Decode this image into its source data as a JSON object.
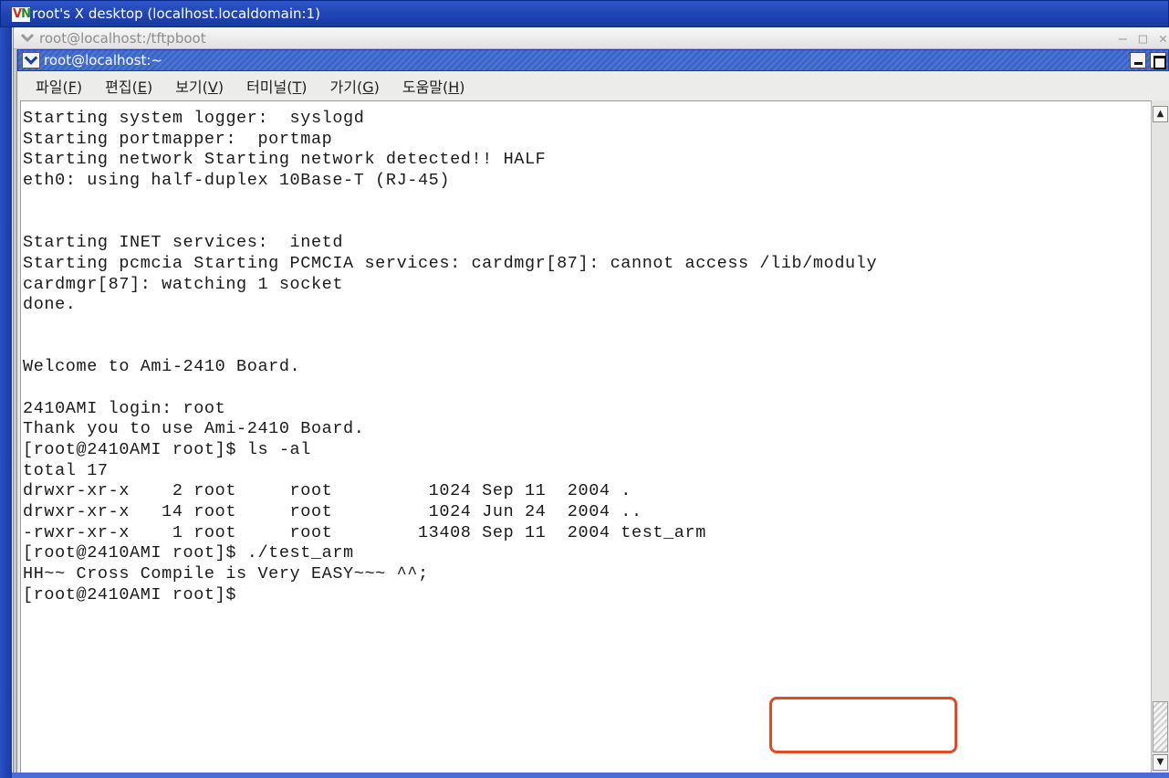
{
  "vnc": {
    "logo_v": "V",
    "logo_n": "N",
    "title": "root's X desktop (localhost.localdomain:1)"
  },
  "back_window": {
    "title": "root@localhost:/tftpboot",
    "controls": "– □ ✕"
  },
  "terminal": {
    "title": "root@localhost:~",
    "menu": [
      {
        "label": "파일(",
        "accel": "F",
        "tail": ")"
      },
      {
        "label": "편집(",
        "accel": "E",
        "tail": ")"
      },
      {
        "label": "보기(",
        "accel": "V",
        "tail": ")"
      },
      {
        "label": "터미널(",
        "accel": "T",
        "tail": ")"
      },
      {
        "label": "가기(",
        "accel": "G",
        "tail": ")"
      },
      {
        "label": "도움말(",
        "accel": "H",
        "tail": ")"
      }
    ],
    "lines": [
      "Starting system logger:  syslogd",
      "Starting portmapper:  portmap",
      "Starting network Starting network detected!! HALF",
      "eth0: using half-duplex 10Base-T (RJ-45)",
      "",
      "",
      "Starting INET services:  inetd",
      "Starting pcmcia Starting PCMCIA services: cardmgr[87]: cannot access /lib/moduly",
      "cardmgr[87]: watching 1 socket",
      "done.",
      "",
      "",
      "Welcome to Ami-2410 Board.",
      "",
      "2410AMI login: root",
      "Thank you to use Ami-2410 Board.",
      "[root@2410AMI root]$ ls -al",
      "total 17",
      "drwxr-xr-x    2 root     root         1024 Sep 11  2004 .",
      "drwxr-xr-x   14 root     root         1024 Jun 24  2004 ..",
      "-rwxr-xr-x    1 root     root        13408 Sep 11  2004 test_arm",
      "[root@2410AMI root]$ ./test_arm",
      "HH~~ Cross Compile is Very EASY~~~ ^^;",
      "[root@2410AMI root]$"
    ]
  },
  "colors": {
    "vnc_titlebar": "#1f43b4",
    "terminal_titlebar": "#3a66cc",
    "highlight_box": "#e34a20",
    "terminal_background": "#ffffff",
    "text": "#1a1a1a"
  },
  "icons": {
    "window_menu": "chevron-down-icon",
    "minimize": "minimize-icon",
    "maximize": "maximize-icon",
    "scroll_up": "arrow-up-icon",
    "scroll_down": "arrow-down-icon"
  }
}
